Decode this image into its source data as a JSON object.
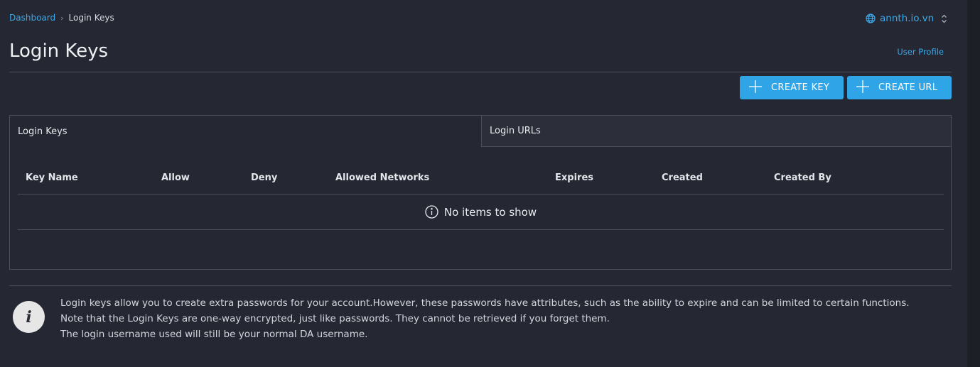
{
  "breadcrumb": {
    "root": "Dashboard",
    "separator": "›",
    "current": "Login Keys"
  },
  "domain_selector": {
    "value": "annth.io.vn",
    "icon": "globe-icon",
    "toggle_icon": "chevron-updown-icon"
  },
  "page": {
    "title": "Login Keys",
    "user_profile_link": "User Profile"
  },
  "actions": {
    "create_key": "CREATE KEY",
    "create_url": "CREATE URL"
  },
  "tabs": [
    {
      "label": "Login Keys",
      "active": true
    },
    {
      "label": "Login URLs",
      "active": false
    }
  ],
  "table": {
    "columns": [
      "Key Name",
      "Allow",
      "Deny",
      "Allowed Networks",
      "Expires",
      "Created",
      "Created By"
    ],
    "rows": [],
    "empty_message": "No items to show"
  },
  "info": {
    "icon": "info-icon",
    "icon_glyph": "i",
    "lines": [
      "Login keys allow you to create extra passwords for your account.However, these passwords have attributes, such as the ability to expire and can be limited to certain functions.",
      "Note that the Login Keys are one-way encrypted, just like passwords. They cannot be retrieved if you forget them.",
      "The login username used will still be your normal DA username."
    ]
  },
  "colors": {
    "accent": "#2fa4e7",
    "link": "#3ea7e8",
    "background": "#252832",
    "border": "#4a4e59"
  }
}
